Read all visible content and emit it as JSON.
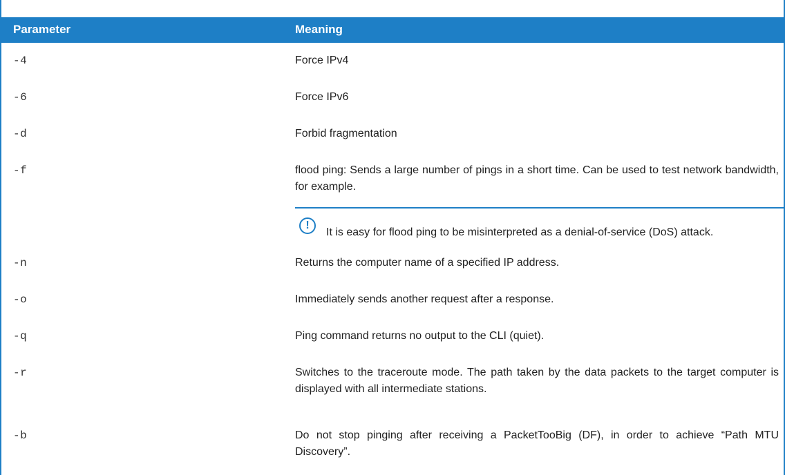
{
  "header": {
    "parameter_label": "Parameter",
    "meaning_label": "Meaning"
  },
  "rows": [
    {
      "param": "-4",
      "meaning": "Force IPv4"
    },
    {
      "param": "-6",
      "meaning": "Force IPv6"
    },
    {
      "param": "-d",
      "meaning": "Forbid fragmentation"
    },
    {
      "param": "-f",
      "meaning": "flood ping: Sends a large number of pings in a short time. Can be used to test network bandwidth, for example.",
      "note": "It is easy for flood ping to be misinterpreted as a denial-of-service (DoS) attack.",
      "note_icon": "exclamation-circle-icon"
    },
    {
      "param": "-n",
      "meaning": "Returns the computer name of a specified IP address."
    },
    {
      "param": "-o",
      "meaning": "Immediately sends another request after a response."
    },
    {
      "param": "-q",
      "meaning": "Ping command returns no output to the CLI (quiet)."
    },
    {
      "param": "-r",
      "meaning": "Switches to the traceroute mode. The path taken by the data packets to the target computer is displayed with all intermediate stations."
    },
    {
      "param": "-b",
      "meaning": "Do not stop pinging after receiving a PacketTooBig (DF), in order to achieve “Path MTU Discovery”."
    }
  ],
  "colors": {
    "accent": "#1e7fc6"
  }
}
